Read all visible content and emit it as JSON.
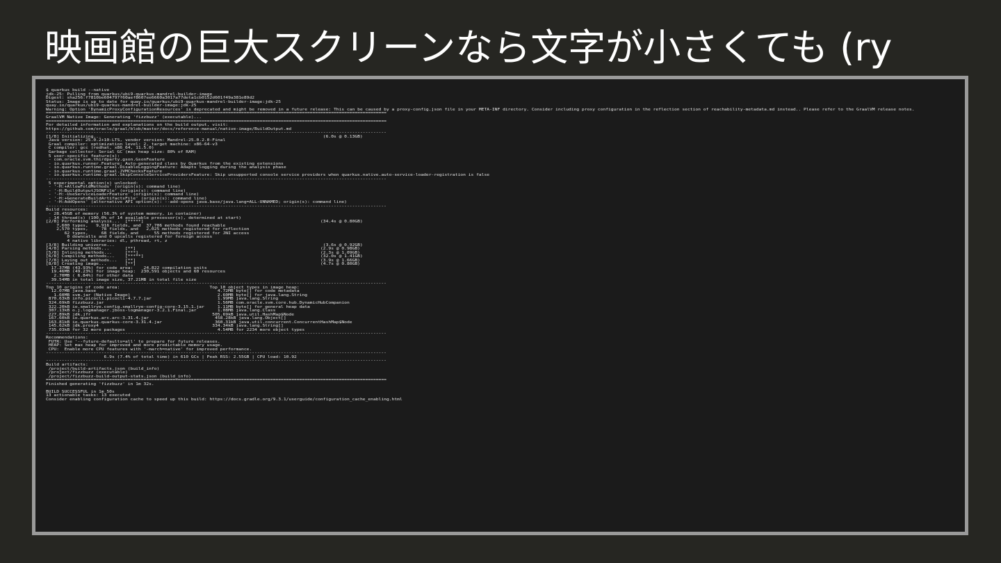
{
  "slide": {
    "title": "映画館の巨大スクリーンなら文字が小さくても (ry"
  },
  "terminal": {
    "lines": [
      "$ quarkus build --native",
      "jdk-25: Pulling from quarkus/ubi9-quarkus-mandrel-builder-image",
      "Digest: sha256:f7810be604797f60aef8607ee6660a3017a77deta1cb0152d601f49a381e89d2",
      "Status: Image is up to date for quay.io/quarkus/ubi9-quarkus-mandrel-builder-image:jdk-25",
      "quay.io/quarkus/ubi9-quarkus-mandrel-builder-image:jdk-25",
      "Warning: Option 'DynamicProxyConfigurationResources' is deprecated and might be removed in a future release: This can be caused by a proxy-config.json file in your META-INF directory. Consider including proxy configuration in the reflection section of reachability-metadata.md instead.. Please refer to the GraalVM release notes.",
      "=================================================================================================================================",
      "GraalVM Native Image: Generating 'fizzbuzz' (executable)...",
      "=================================================================================================================================",
      "For detailed information and explanations on the build output, visit:",
      "https://github.com/oracle/graal/blob/master/docs/reference-manual/native-image/BuildOutput.md",
      "---------------------------------------------------------------------------------------------------------------------------------",
      "[1/8] Initializing...                                                                                    (6.0s @ 0.13GB)",
      " Java version: 25.0.2+10-LTS, vendor version: Mandrel-25.0.2.0-Final",
      " Graal compiler: optimization level: 2, target machine: x86-64-v3",
      " C compiler: gcc (redhat, x86_64, 11.5.0)",
      " Garbage collector: Serial GC (max heap size: 80% of RAM)",
      " 5 user-specific feature(s):",
      " - com.oracle.svm.thirdparty.gson.GsonFeature",
      " - io.quarkus.runner.Feature: Auto-generated class by Quarkus from the existing extensions",
      " - io.quarkus.runtime.graal.DisableLoggingFeature: Adapts logging during the analysis phase",
      " - io.quarkus.runtime.graal.JVMChecksFeature",
      " - io.quarkus.runtime.graal.SkipConsoleServiceProvidersFeature: Skip unsupported console service providers when quarkus.native.auto-service-loader-registration is false",
      "---------------------------------------------------------------------------------------------------------------------------------",
      " 5 experimental option(s) unlocked:",
      " - '-H:+AllowFoldMethods' (origin(s): command line)",
      " - '-H:BuildOutputJSONFile' (origin(s): command line)",
      " - '-H:-UseServiceLoaderFeature' (origin(s): command line)",
      " - '-H:+GenerateBuildArtifactsFile' (origin(s): command line)",
      " - '-H:AddOpens' (alternative API option(s): --add-opens java.base/java.lang=ALL-UNNAMED; origin(s): command line)",
      "---------------------------------------------------------------------------------------------------------------------------------",
      "Build resources:",
      " - 28.45GB of memory (56.3% of system memory, in container)",
      " - 14 thread(s) (100.0% of 14 available processor(s), determined at start)",
      "[2/8] Performing analysis...  [*****]                                                                   (34.4s @ 0.80GB)",
      "    7,600 types,   9,916 fields, and  37,706 methods found reachable",
      "    2,570 types,     78 fields, and   2,025 methods registered for reflection",
      "       62 types,     68 fields, and      55 methods registered for JNI access",
      "        0 downcalls and 0 upcalls registered for foreign access",
      "        4 native libraries: dl, pthread, rt, z",
      "[3/8] Building universe...                                                                               (3.6s @ 0.92GB)",
      "[4/8] Parsing methods...      [**]                                                                      (2.9s @ 0.98GB)",
      "[5/8] Inlining methods...     [***]                                                                     (2.3s @ 1.09GB)",
      "[6/8] Compiling methods...    [*****]                                                                   (32.0s @ 1.41GB)",
      "[7/8] Laying out methods...   [**]                                                                      (3.9s @ 1.66GB)",
      "[8/8] Creating image...       [**]                                                                      (4.7s @ 0.80GB)",
      "  17.37MB (43.93%) for code area:    24,822 compilation units",
      "  19.46MB (49.23%) for image heap:  230,591 objects and 60 resources",
      "   2.70MB ( 6.84%) for other data",
      "  39.54MB in total image size, 37.21MB in total file size",
      "---------------------------------------------------------------------------------------------------------------------------------",
      "Top 10 origins of code area:                                  Top 10 object types in image heap:",
      "  12.07MB java.base                                              4.72MB byte[] for code metadata",
      "   1.60MB svm.jar (Native Image)                                 2.60MB byte[] for java.lang.String",
      " 870.63kB info.picocli.picocli-4.7.7.jar                         1.99MB java.lang.String",
      " 324.69kB fizzbuzz.jar                                           1.56MB com.oracle.svm.core.hub.DynamicHubCompanion",
      " 322.20kB io.smallrye.config.smallrye-config-core-3.15.1.jar     1.11MB byte[] for general heap data",
      " 307.13kB o.j.logmanager.jboss-logmanager-3.2.1.Final.jar        1.08MB java.lang.Class",
      " 227.89kB jdk.jfr                                              505.69kB java.util.HashMap$Node",
      " 167.60kB io.quarkus.arc.arc-3.31.4.jar                         458.28kB java.lang.Object[]",
      " 163.81kB io.quarkus.quarkus-core-3.31.4.jar                    360.31kB java.util.concurrent.ConcurrentHashMap$Node",
      " 145.62kB jdk.proxy4                                           334.34kB java.lang.String[]",
      " 735.03kB for 32 more packages                                   4.54MB for 2234 more object types",
      "---------------------------------------------------------------------------------------------------------------------------------",
      "Recommendations:",
      " FUTR: Use '--future-defaults=all' to prepare for future releases.",
      " HEAP: Set max heap for improved and more predictable memory usage.",
      " CPU:  Enable more CPU features with '-march=native' for improved performance.",
      "---------------------------------------------------------------------------------------------------------------------------------",
      "                      6.9s (7.4% of total time) in 610 GCs | Peak RSS: 2.55GB | CPU load: 10.92",
      "---------------------------------------------------------------------------------------------------------------------------------",
      "Build artifacts:",
      " /project/build-artifacts.json (build_info)",
      " /project/fizzbuzz (executable)",
      " /project/fizzbuzz-build-output-stats.json (build_info)",
      "=================================================================================================================================",
      "Finished generating 'fizzbuzz' in 1m 32s.",
      "",
      "BUILD SUCCESSFUL in 1m 50s",
      "13 actionable tasks: 13 executed",
      "Consider enabling configuration cache to speed up this build: https://docs.gradle.org/9.3.1/userguide/configuration_cache_enabling.html"
    ]
  }
}
